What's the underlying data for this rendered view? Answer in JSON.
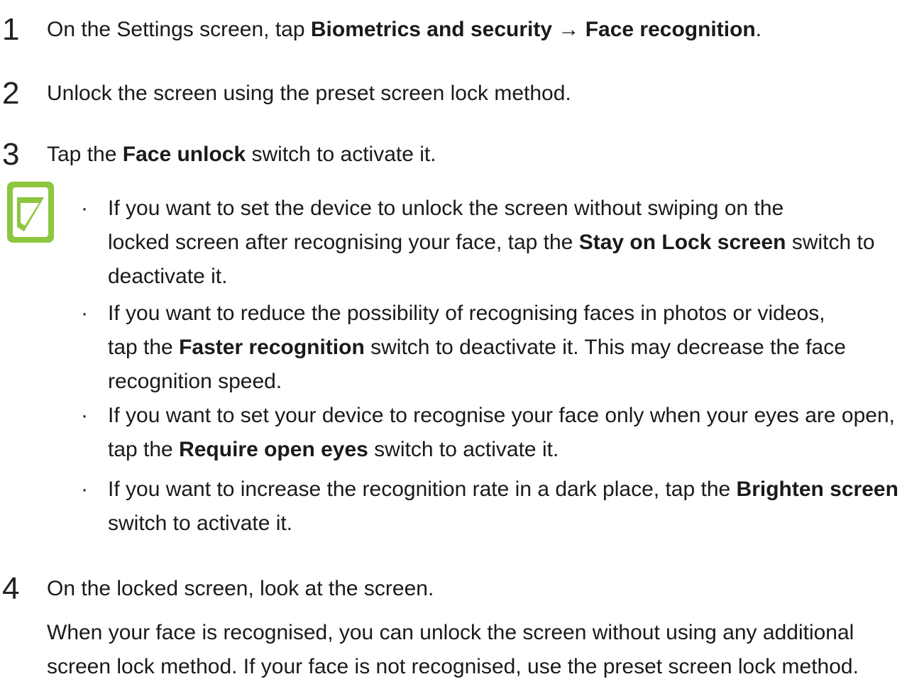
{
  "steps": [
    {
      "num": "1",
      "pre": "On the Settings screen, tap ",
      "b1": "Biometrics and security",
      "mid": " → ",
      "b2": "Face recognition",
      "post": "."
    },
    {
      "num": "2",
      "text": "Unlock the screen using the preset screen lock method."
    },
    {
      "num": "3",
      "pre": "Tap the ",
      "b1": "Face unlock",
      "post": " switch to activate it."
    },
    {
      "num": "4",
      "text": "On the locked screen, look at the screen."
    }
  ],
  "note": {
    "icon": "note-pencil-icon",
    "bullets": [
      {
        "line1": "If you want to set the device to unlock the screen without swiping on the",
        "line2_pre": "locked screen after recognising your face, tap the ",
        "line2_bold": "Stay on Lock screen",
        "line2_post": " switch to",
        "line3": "deactivate it."
      },
      {
        "line1": "If you want to reduce the possibility of recognising faces in photos or videos,",
        "line2_pre": "tap the ",
        "line2_bold": "Faster recognition",
        "line2_post": " switch to deactivate it. This may decrease the face",
        "line3": "recognition speed."
      },
      {
        "line1": "If you want to set your device to recognise your face only when your eyes are open,",
        "line2_pre": "tap the ",
        "line2_bold": "Require open eyes",
        "line2_post": " switch to activate it."
      },
      {
        "line1_pre": "If you want to increase the recognition rate in a dark place, tap the ",
        "line1_bold": "Brighten screen",
        "line2": "switch to activate it."
      }
    ]
  },
  "step4_para": {
    "line1": "When your face is recognised, you can unlock the screen without using any additional",
    "line2": "screen lock method. If your face is not recognised, use the preset screen lock method."
  },
  "colors": {
    "icon_green": "#8dc63f"
  }
}
